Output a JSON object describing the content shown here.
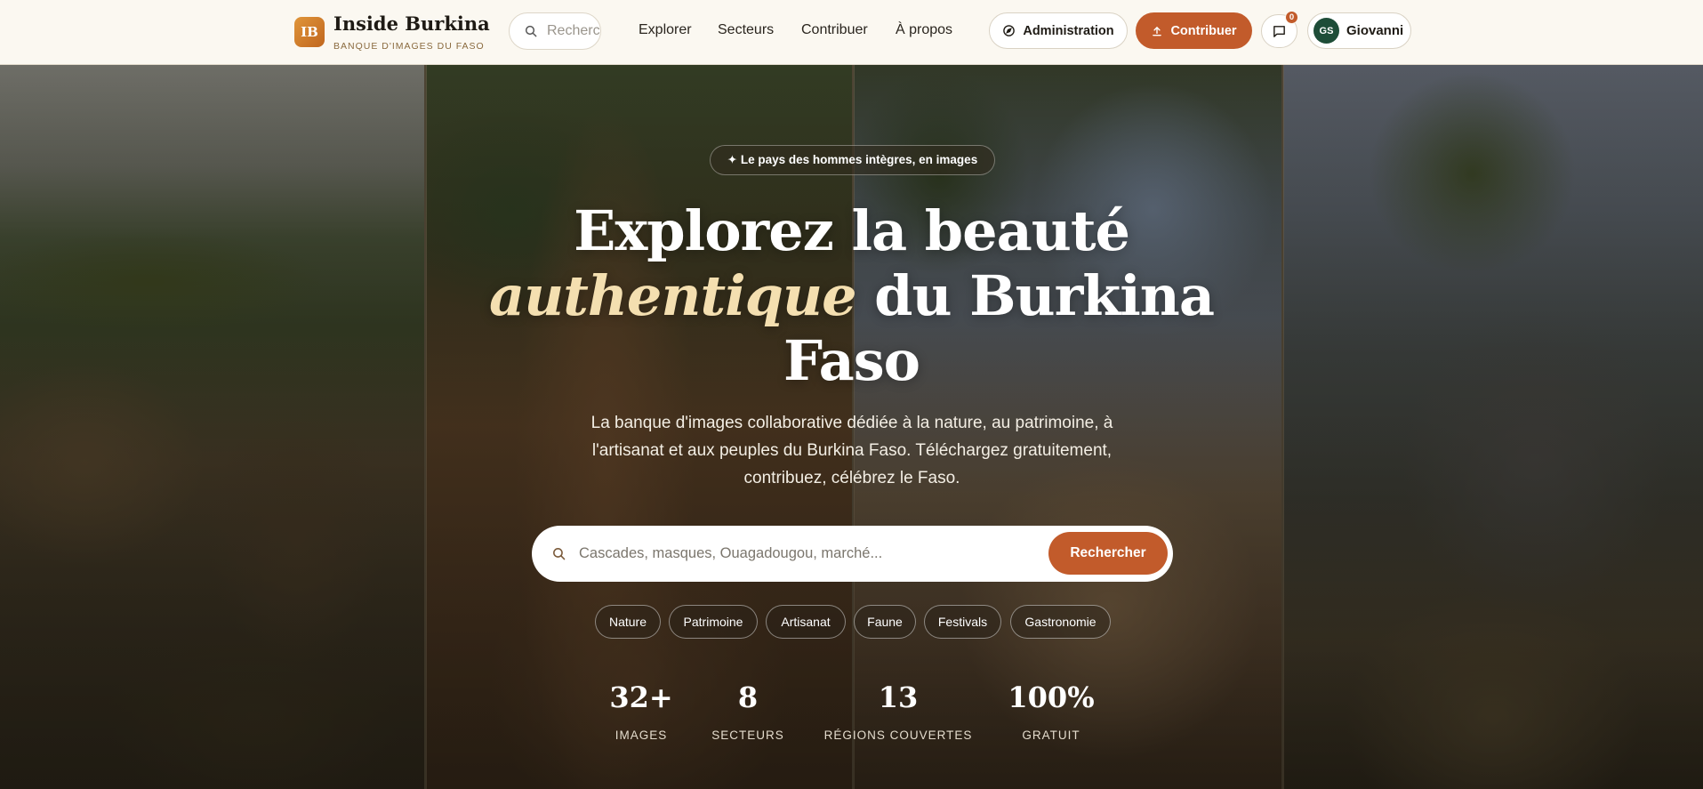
{
  "brand": {
    "logo": "IB",
    "title": "Inside Burkina",
    "subtitle": "BANQUE D'IMAGES DU FASO"
  },
  "header_search": {
    "placeholder": "Rechercher"
  },
  "nav": [
    "Explorer",
    "Secteurs",
    "Contribuer",
    "À propos"
  ],
  "actions": {
    "admin_label": "Administration",
    "contribute_label": "Contribuer",
    "messages_count": "0",
    "user_initials": "GS",
    "user_name": "Giovanni"
  },
  "hero": {
    "tagline": "✦ Le pays des hommes intègres, en images",
    "title_part1": "Explorez la beauté",
    "title_accent": "authentique",
    "title_part2": "du Burkina Faso",
    "lede": "La banque d'images collaborative dédiée à la nature, au patrimoine, à l'artisanat et aux peuples du Burkina Faso. Téléchargez gratuitement, contribuez, célébrez le Faso.",
    "search_placeholder": "Cascades, masques, Ouagadougou, marché...",
    "search_button": "Rechercher",
    "categories": [
      "Nature",
      "Patrimoine",
      "Artisanat",
      "Faune",
      "Festivals",
      "Gastronomie"
    ],
    "stats": [
      {
        "value": "32+",
        "label": "IMAGES"
      },
      {
        "value": "8",
        "label": "SECTEURS"
      },
      {
        "value": "13",
        "label": "RÉGIONS COUVERTES"
      },
      {
        "value": "100%",
        "label": "GRATUIT"
      }
    ]
  },
  "icons": [
    "search-icon",
    "compass-icon",
    "upload-icon",
    "message-icon"
  ],
  "colors": {
    "accent": "#c25b2b",
    "header_bg": "#fbf8f1",
    "title_accent": "#f4dfb0"
  }
}
